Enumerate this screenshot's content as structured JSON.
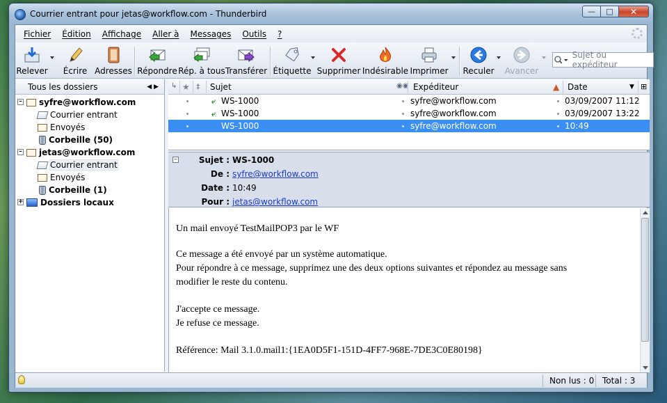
{
  "window": {
    "title": "Courrier entrant pour jetas@workflow.com - Thunderbird"
  },
  "menu": [
    "Fichier",
    "Édition",
    "Affichage",
    "Aller à",
    "Messages",
    "Outils",
    "?"
  ],
  "toolbar": {
    "relever": "Relever",
    "ecrire": "Écrire",
    "adresses": "Adresses",
    "repondre": "Répondre",
    "rep_tous": "Rép. à tous",
    "transferer": "Transférer",
    "etiquette": "Étiquette",
    "supprimer": "Supprimer",
    "indesirable": "Indésirable",
    "imprimer": "Imprimer",
    "reculer": "Reculer",
    "avancer": "Avancer"
  },
  "search": {
    "placeholder": "Sujet ou expéditeur"
  },
  "sidebar": {
    "header": "Tous les dossiers",
    "accounts": [
      {
        "name": "syfre@workflow.com",
        "folders": [
          "Courrier entrant",
          "Envoyés",
          "Corbeille (50)"
        ]
      },
      {
        "name": "jetas@workflow.com",
        "folders": [
          "Courrier entrant",
          "Envoyés",
          "Corbeille (1)"
        ]
      }
    ],
    "local": "Dossiers locaux"
  },
  "thread": {
    "columns": {
      "subject": "Sujet",
      "sender": "Expéditeur",
      "date": "Date"
    },
    "rows": [
      {
        "subject": "WS-1000",
        "sender": "syfre@workflow.com",
        "date": "03/09/2007 11:12"
      },
      {
        "subject": "WS-1000",
        "sender": "syfre@workflow.com",
        "date": "03/09/2007 13:22"
      },
      {
        "subject": "WS-1000",
        "sender": "syfre@workflow.com",
        "date": "10:49"
      }
    ]
  },
  "message": {
    "subject_label": "Sujet :",
    "subject": "WS-1000",
    "from_label": "De :",
    "from": "syfre@workflow.com",
    "date_label": "Date :",
    "date": "10:49",
    "to_label": "Pour :",
    "to": "jetas@workflow.com",
    "body": [
      "Un mail envoyé TestMailPOP3 par le WF",
      "Ce message a été envoyé par un système automatique.",
      "Pour répondre à ce message, supprimez une des deux options suivantes et répondez au message sans",
      "modifier le reste du contenu.",
      "J'accepte ce message.",
      "Je refuse ce message.",
      "Référence: Mail 3.1.0.mail1:{1EA0D5F1-151D-4FF7-968E-7DE3C0E80198}"
    ]
  },
  "status": {
    "unread": "Non lus : 0",
    "total": "Total : 3"
  }
}
